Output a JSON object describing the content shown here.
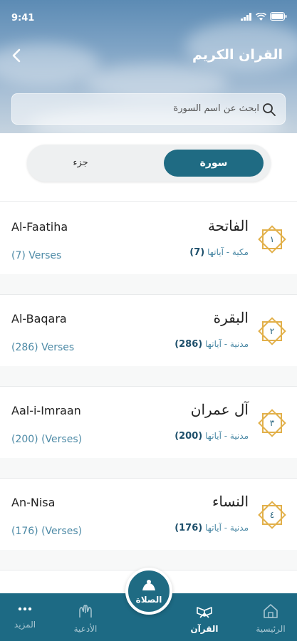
{
  "status_bar": {
    "time": "9:41"
  },
  "header": {
    "title": "القران الكريم",
    "search_placeholder": "ابحث عن اسم السورة"
  },
  "tabs": {
    "active": "سورة",
    "inactive": "جزء"
  },
  "surahs": [
    {
      "name_en": "Al-Faatiha",
      "verses_en": "(7) Verses",
      "name_ar": "الفاتحة",
      "type_ar": "مكية - آياتها",
      "count_ar": "(7)",
      "number": "١"
    },
    {
      "name_en": "Al-Baqara",
      "verses_en": "(286) Verses",
      "name_ar": "البقرة",
      "type_ar": "مدنية - آياتها",
      "count_ar": "(286)",
      "number": "٢"
    },
    {
      "name_en": "Aal-i-Imraan",
      "verses_en": "(200) (Verses)",
      "name_ar": "آل عمران",
      "type_ar": "مدنية - آياتها",
      "count_ar": "(200)",
      "number": "٣"
    },
    {
      "name_en": "An-Nisa",
      "verses_en": "(176) (Verses)",
      "name_ar": "النساء",
      "type_ar": "مدنية - آياتها",
      "count_ar": "(176)",
      "number": "٤"
    }
  ],
  "bottom_nav": {
    "home": "الرئيسية",
    "quran": "القرآن",
    "prayer": "الصلاة",
    "duas": "الأدعية",
    "more": "المزيد"
  },
  "colors": {
    "primary": "#1f6b83",
    "accent": "#4d8aa6",
    "star_gold": "#e2b04a"
  },
  "icons": [
    "back-arrow-icon",
    "search-icon",
    "octagram-star-icon",
    "home-icon",
    "quran-book-icon",
    "prayer-icon",
    "dua-hands-icon",
    "more-dots-icon"
  ]
}
